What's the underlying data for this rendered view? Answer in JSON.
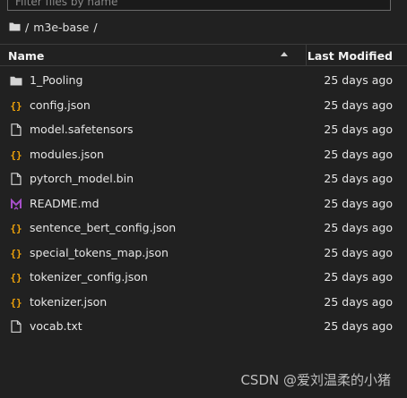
{
  "filter": {
    "placeholder": "Filter files by name"
  },
  "breadcrumb": {
    "root": "/",
    "folder": "m3e-base",
    "trail": "/"
  },
  "header": {
    "name_label": "Name",
    "modified_label": "Last Modified"
  },
  "files": [
    {
      "name": "1_Pooling",
      "modified": "25 days ago",
      "icon": "folder-icon"
    },
    {
      "name": "config.json",
      "modified": "25 days ago",
      "icon": "json-icon"
    },
    {
      "name": "model.safetensors",
      "modified": "25 days ago",
      "icon": "file-icon"
    },
    {
      "name": "modules.json",
      "modified": "25 days ago",
      "icon": "json-icon"
    },
    {
      "name": "pytorch_model.bin",
      "modified": "25 days ago",
      "icon": "file-icon"
    },
    {
      "name": "README.md",
      "modified": "25 days ago",
      "icon": "markdown-icon"
    },
    {
      "name": "sentence_bert_config.json",
      "modified": "25 days ago",
      "icon": "json-icon"
    },
    {
      "name": "special_tokens_map.json",
      "modified": "25 days ago",
      "icon": "json-icon"
    },
    {
      "name": "tokenizer_config.json",
      "modified": "25 days ago",
      "icon": "json-icon"
    },
    {
      "name": "tokenizer.json",
      "modified": "25 days ago",
      "icon": "json-icon"
    },
    {
      "name": "vocab.txt",
      "modified": "25 days ago",
      "icon": "file-icon"
    }
  ],
  "watermark": "CSDN @爱刘温柔的小猪",
  "colors": {
    "background": "#212121",
    "json_icon": "#f0a30a",
    "markdown_icon": "#a64fc9",
    "text": "#e6e6e6"
  }
}
